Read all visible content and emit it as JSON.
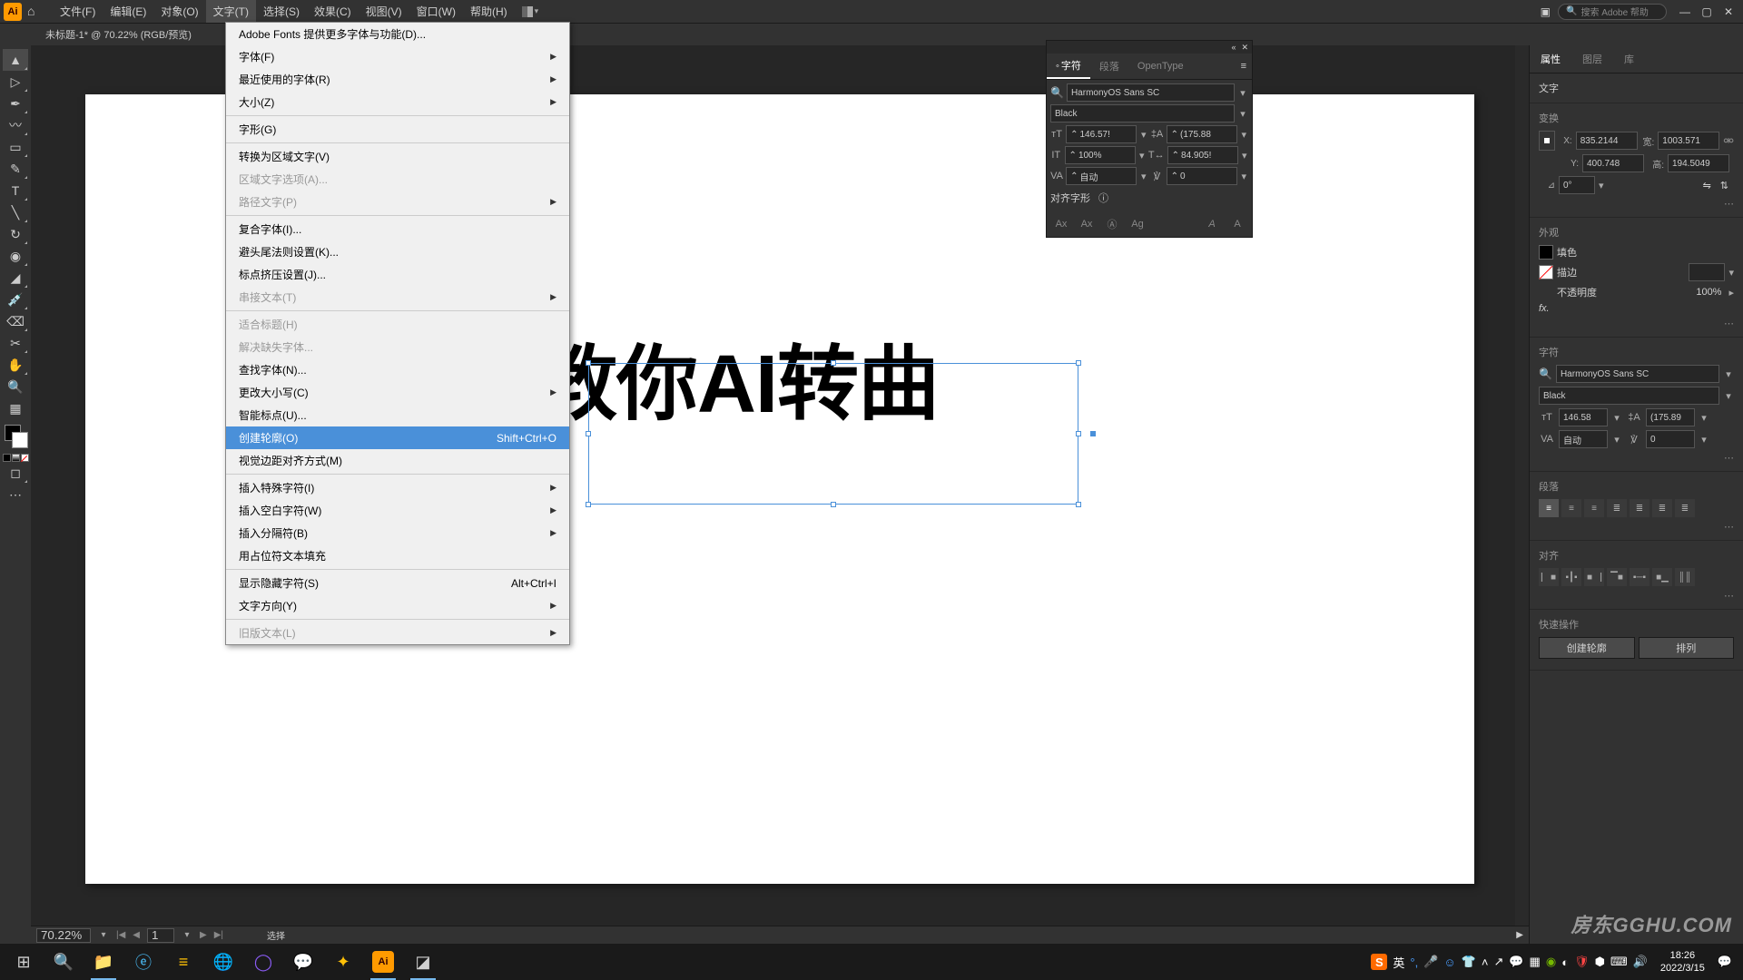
{
  "menubar": {
    "items": [
      "文件(F)",
      "编辑(E)",
      "对象(O)",
      "文字(T)",
      "选择(S)",
      "效果(C)",
      "视图(V)",
      "窗口(W)",
      "帮助(H)"
    ],
    "search_placeholder": "搜索 Adobe 帮助"
  },
  "doc_tab": "未标题-1* @ 70.22% (RGB/预览)",
  "canvas": {
    "text": "教你AI转曲"
  },
  "dropdown": {
    "groups": [
      [
        {
          "label": "Adobe Fonts 提供更多字体与功能(D)...",
          "sub": false
        },
        {
          "label": "字体(F)",
          "sub": true
        },
        {
          "label": "最近使用的字体(R)",
          "sub": true
        },
        {
          "label": "大小(Z)",
          "sub": true
        }
      ],
      [
        {
          "label": "字形(G)",
          "sub": false
        }
      ],
      [
        {
          "label": "转换为区域文字(V)",
          "sub": false
        },
        {
          "label": "区域文字选项(A)...",
          "sub": false,
          "disabled": true
        },
        {
          "label": "路径文字(P)",
          "sub": true,
          "disabled": true
        }
      ],
      [
        {
          "label": "复合字体(I)...",
          "sub": false
        },
        {
          "label": "避头尾法则设置(K)...",
          "sub": false
        },
        {
          "label": "标点挤压设置(J)...",
          "sub": false
        },
        {
          "label": "串接文本(T)",
          "sub": true,
          "disabled": true
        }
      ],
      [
        {
          "label": "适合标题(H)",
          "sub": false,
          "disabled": true
        },
        {
          "label": "解决缺失字体...",
          "sub": false,
          "disabled": true
        },
        {
          "label": "查找字体(N)...",
          "sub": false
        },
        {
          "label": "更改大小写(C)",
          "sub": true
        },
        {
          "label": "智能标点(U)...",
          "sub": false
        },
        {
          "label": "创建轮廓(O)",
          "sub": false,
          "shortcut": "Shift+Ctrl+O",
          "hl": true
        },
        {
          "label": "视觉边距对齐方式(M)",
          "sub": false
        }
      ],
      [
        {
          "label": "插入特殊字符(I)",
          "sub": true
        },
        {
          "label": "插入空白字符(W)",
          "sub": true
        },
        {
          "label": "插入分隔符(B)",
          "sub": true
        },
        {
          "label": "用占位符文本填充",
          "sub": false
        }
      ],
      [
        {
          "label": "显示隐藏字符(S)",
          "sub": false,
          "shortcut": "Alt+Ctrl+I"
        },
        {
          "label": "文字方向(Y)",
          "sub": true
        }
      ],
      [
        {
          "label": "旧版文本(L)",
          "sub": true,
          "disabled": true
        }
      ]
    ]
  },
  "char_panel": {
    "tabs": [
      "字符",
      "段落",
      "OpenType"
    ],
    "font": "HarmonyOS Sans SC",
    "weight": "Black",
    "size": "146.57!",
    "leading": "(175.88",
    "vscale": "100%",
    "hscale": "84.905!",
    "kerning": "自动",
    "tracking": "0",
    "align_label": "对齐字形"
  },
  "right_panel": {
    "tabs": [
      "属性",
      "图层",
      "库"
    ],
    "type_label": "文字",
    "transform": {
      "title": "变换",
      "x": "835.2144",
      "y": "400.748",
      "w": "1003.571",
      "h": "194.5049",
      "rotate": "0°"
    },
    "appearance": {
      "title": "外观",
      "fill": "填色",
      "stroke": "描边",
      "opacity_label": "不透明度",
      "opacity": "100%",
      "fx": "fx."
    },
    "char": {
      "title": "字符",
      "font": "HarmonyOS Sans SC",
      "weight": "Black",
      "size": "146.58",
      "leading": "(175.89",
      "kerning": "自动",
      "tracking": "0"
    },
    "para": {
      "title": "段落"
    },
    "align": {
      "title": "对齐"
    },
    "quick": {
      "title": "快速操作",
      "outline": "创建轮廓",
      "arrange": "排列"
    }
  },
  "status": {
    "zoom": "70.22%",
    "page": "1",
    "tool": "选择"
  },
  "taskbar": {
    "time": "18:26",
    "date": "2022/3/15",
    "ime": "英"
  },
  "watermark": "房东GGHU.COM"
}
